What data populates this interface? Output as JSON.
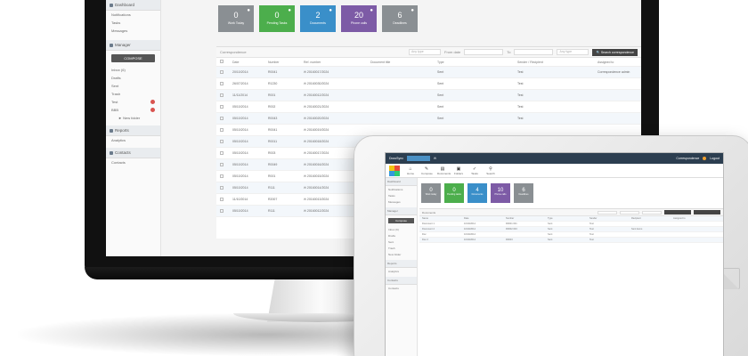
{
  "monitor": {
    "sidebar": {
      "dashboard_header": "Dashboard",
      "dashboard_links": [
        "Notifications",
        "Tasks",
        "Messages"
      ],
      "manager_header": "Manager",
      "compose_label": "COMPOSE",
      "folders": [
        {
          "label": "Inbox (6)",
          "flag": false
        },
        {
          "label": "Drafts",
          "flag": false
        },
        {
          "label": "Sent",
          "flag": false
        },
        {
          "label": "Trash",
          "flag": false
        },
        {
          "label": "Test",
          "flag": true
        },
        {
          "label": "BBB",
          "flag": true
        }
      ],
      "new_folder_label": "New folder",
      "reports_header": "Reports",
      "reports_links": [
        "Analytics"
      ],
      "contacts_header": "Contacts",
      "contacts_links": [
        "Contacts"
      ]
    },
    "tiles": [
      {
        "count": "0",
        "label": "Work Today",
        "color": "#8a8f93",
        "icon": "clock-icon"
      },
      {
        "count": "0",
        "label": "Pending Tasks",
        "color": "#4cae4c",
        "icon": "flask-icon"
      },
      {
        "count": "2",
        "label": "Documents",
        "color": "#3a8fc9",
        "icon": "document-icon"
      },
      {
        "count": "20",
        "label": "Phone calls",
        "color": "#7d5ba6",
        "icon": "phone-icon"
      },
      {
        "count": "6",
        "label": "Deadlines",
        "color": "#8a8f93",
        "icon": "clock-icon"
      }
    ],
    "panel": {
      "title": "Correspondence",
      "from_label": "From date",
      "to_label": "To",
      "filter_placeholder": "Any type",
      "button_label": "Search correspondence"
    },
    "columns": [
      "",
      "Date",
      "Number",
      "Ref. number",
      "Document title",
      "Type",
      "Sender / Recipient",
      "Assigned to"
    ],
    "rows": [
      {
        "date": "20/10/2014",
        "num": "R0041",
        "ref": "20160017/2024",
        "title": "",
        "type": "Sent",
        "sender": "Test",
        "assigned": "Correspondence admin"
      },
      {
        "date": "26/07/2014",
        "num": "R1230",
        "ref": "20160030/2024",
        "title": "",
        "type": "Sent",
        "sender": "Test",
        "assigned": ""
      },
      {
        "date": "11/11/2014",
        "num": "R001",
        "ref": "20160012/2024",
        "title": "",
        "type": "Sent",
        "sender": "Test",
        "assigned": ""
      },
      {
        "date": "05/10/2014",
        "num": "R002",
        "ref": "20160021/2024",
        "title": "",
        "type": "Sent",
        "sender": "Test",
        "assigned": ""
      },
      {
        "date": "05/10/2014",
        "num": "R0043",
        "ref": "20160020/2024",
        "title": "",
        "type": "Sent",
        "sender": "Test",
        "assigned": ""
      },
      {
        "date": "05/10/2014",
        "num": "R0041",
        "ref": "20160019/2024",
        "title": "",
        "type": "",
        "sender": "",
        "assigned": ""
      },
      {
        "date": "05/10/2014",
        "num": "R0011",
        "ref": "20160018/2024",
        "title": "",
        "type": "",
        "sender": "",
        "assigned": ""
      },
      {
        "date": "05/10/2014",
        "num": "R003",
        "ref": "20160017/2024",
        "title": "",
        "type": "",
        "sender": "",
        "assigned": ""
      },
      {
        "date": "05/10/2014",
        "num": "R0049",
        "ref": "20160016/2024",
        "title": "",
        "type": "",
        "sender": "",
        "assigned": ""
      },
      {
        "date": "05/10/2014",
        "num": "R001",
        "ref": "20160015/2024",
        "title": "",
        "type": "",
        "sender": "",
        "assigned": ""
      },
      {
        "date": "05/10/2014",
        "num": "R111",
        "ref": "20160014/2024",
        "title": "",
        "type": "",
        "sender": "",
        "assigned": ""
      },
      {
        "date": "11/10/2014",
        "num": "R2007",
        "ref": "20160013/2024",
        "title": "",
        "type": "",
        "sender": "",
        "assigned": ""
      },
      {
        "date": "05/10/2014",
        "num": "R111",
        "ref": "20160012/2024",
        "title": "",
        "type": "",
        "sender": "",
        "assigned": ""
      }
    ]
  },
  "tablet": {
    "brand": "DocuSync",
    "user_label": "Correspondence",
    "logout_label": "Logout",
    "toolbar": [
      "Home",
      "Compose",
      "Documents",
      "Folders",
      "Tasks",
      "Search"
    ],
    "sidebar": {
      "dashboard_header": "Dashboard",
      "dashboard_links": [
        "Notifications",
        "Tasks",
        "Messages"
      ],
      "manager_header": "Manager",
      "compose_label": "Compose",
      "folders": [
        "Inbox (6)",
        "Drafts",
        "Sent",
        "Trash",
        "New folder"
      ],
      "reports_header": "Reports",
      "reports_links": [
        "Analytics"
      ],
      "contacts_header": "Contacts",
      "contacts_links": [
        "Contacts"
      ]
    },
    "tiles": [
      {
        "count": "0",
        "label": "Work today",
        "color": "#8a8f93"
      },
      {
        "count": "0",
        "label": "Pending tasks",
        "color": "#4cae4c"
      },
      {
        "count": "4",
        "label": "Documents",
        "color": "#3a8fc9"
      },
      {
        "count": "10",
        "label": "Phone calls",
        "color": "#7d5ba6"
      },
      {
        "count": "6",
        "label": "Deadlines",
        "color": "#8a8f93"
      }
    ],
    "panel_title": "Documents",
    "columns": [
      "Name",
      "Date",
      "Number",
      "Type",
      "Sender",
      "Recipient",
      "Assigned to"
    ],
    "rows": [
      [
        "Document 1",
        "10/10/2014",
        "R0001 001",
        "Sent",
        "Test",
        "",
        ""
      ],
      [
        "Document 2",
        "10/10/2014",
        "R0002 003",
        "Sent",
        "Test",
        "Sent items",
        ""
      ],
      [
        "Doc",
        "10/10/2014",
        "",
        "Sent",
        "Test",
        "",
        ""
      ],
      [
        "Doc 2",
        "10/10/2014",
        "R0003",
        "Sent",
        "Test",
        "",
        ""
      ]
    ]
  }
}
